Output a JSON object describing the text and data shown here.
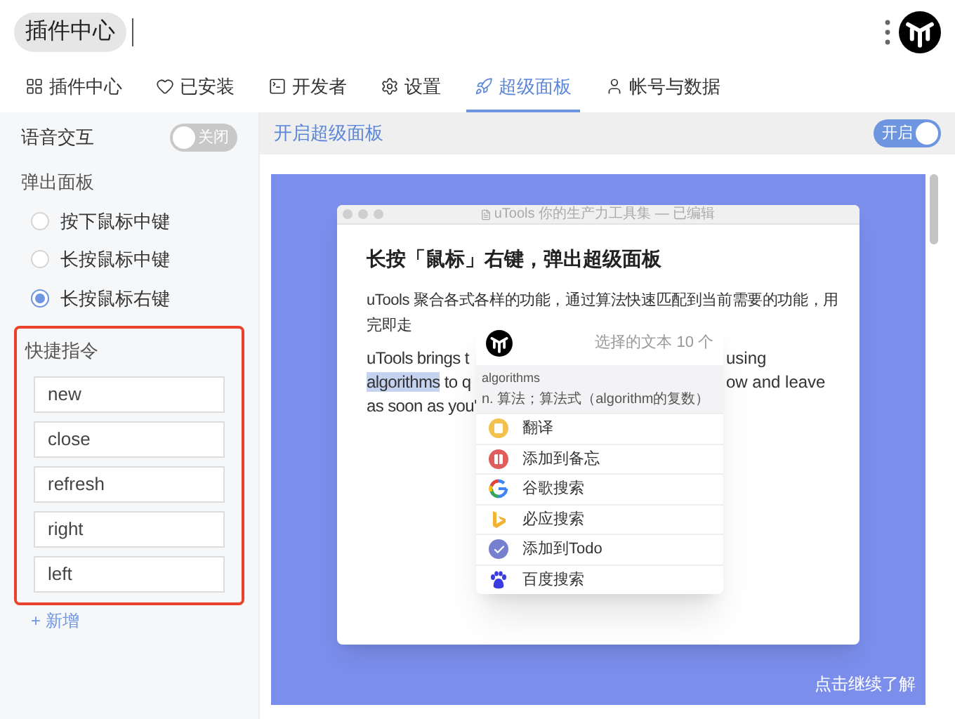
{
  "search": {
    "value": "插件中心"
  },
  "tabs": [
    {
      "label": "插件中心",
      "kind": "grid",
      "selected": false
    },
    {
      "label": "已安装",
      "kind": "heart",
      "selected": false
    },
    {
      "label": "开发者",
      "kind": "terminal",
      "selected": false
    },
    {
      "label": "设置",
      "kind": "gear",
      "selected": false
    },
    {
      "label": "超级面板",
      "kind": "rocket",
      "selected": true
    },
    {
      "label": "帐号与数据",
      "kind": "user",
      "selected": false
    }
  ],
  "sidebar": {
    "voice": {
      "label": "语音交互",
      "on": false,
      "toggle_text": "关闭"
    },
    "popup_title": "弹出面板",
    "popup_options": [
      {
        "label": "按下鼠标中键",
        "selected": false
      },
      {
        "label": "长按鼠标中键",
        "selected": false
      },
      {
        "label": "长按鼠标右键",
        "selected": true
      }
    ],
    "shortcuts_title": "快捷指令",
    "shortcuts": [
      "new",
      "close",
      "refresh",
      "right",
      "left"
    ],
    "add_link": "+ 新增"
  },
  "main": {
    "enable_label": "开启超级面板",
    "enable_on": true,
    "toggle_text": "开启",
    "demo": {
      "window_title": "uTools 你的生产力工具集 — 已编辑",
      "heading": "长按「鼠标」右键，弹出超级面板",
      "paragraph": "uTools 聚合各式各样的功能，通过算法快速匹配到当前需要的功能，用完即走",
      "lines": [
        {
          "left": "uTools brings t",
          "right": "using"
        },
        {
          "highlight": "algorithms",
          "left": " to q",
          "right": "ow and leave"
        },
        {
          "left": "as soon as you'"
        }
      ],
      "popup": {
        "count": "选择的文本 10 个",
        "word": "algorithms",
        "definition": "n. 算法；算法式（algorithm的复数）",
        "items": [
          {
            "label": "翻译",
            "kind": "translate"
          },
          {
            "label": "添加到备忘",
            "kind": "memo"
          },
          {
            "label": "谷歌搜索",
            "kind": "google"
          },
          {
            "label": "必应搜索",
            "kind": "bing"
          },
          {
            "label": "添加到Todo",
            "kind": "todo"
          },
          {
            "label": "百度搜索",
            "kind": "baidu"
          }
        ]
      }
    },
    "learn_more": "点击继续了解"
  }
}
